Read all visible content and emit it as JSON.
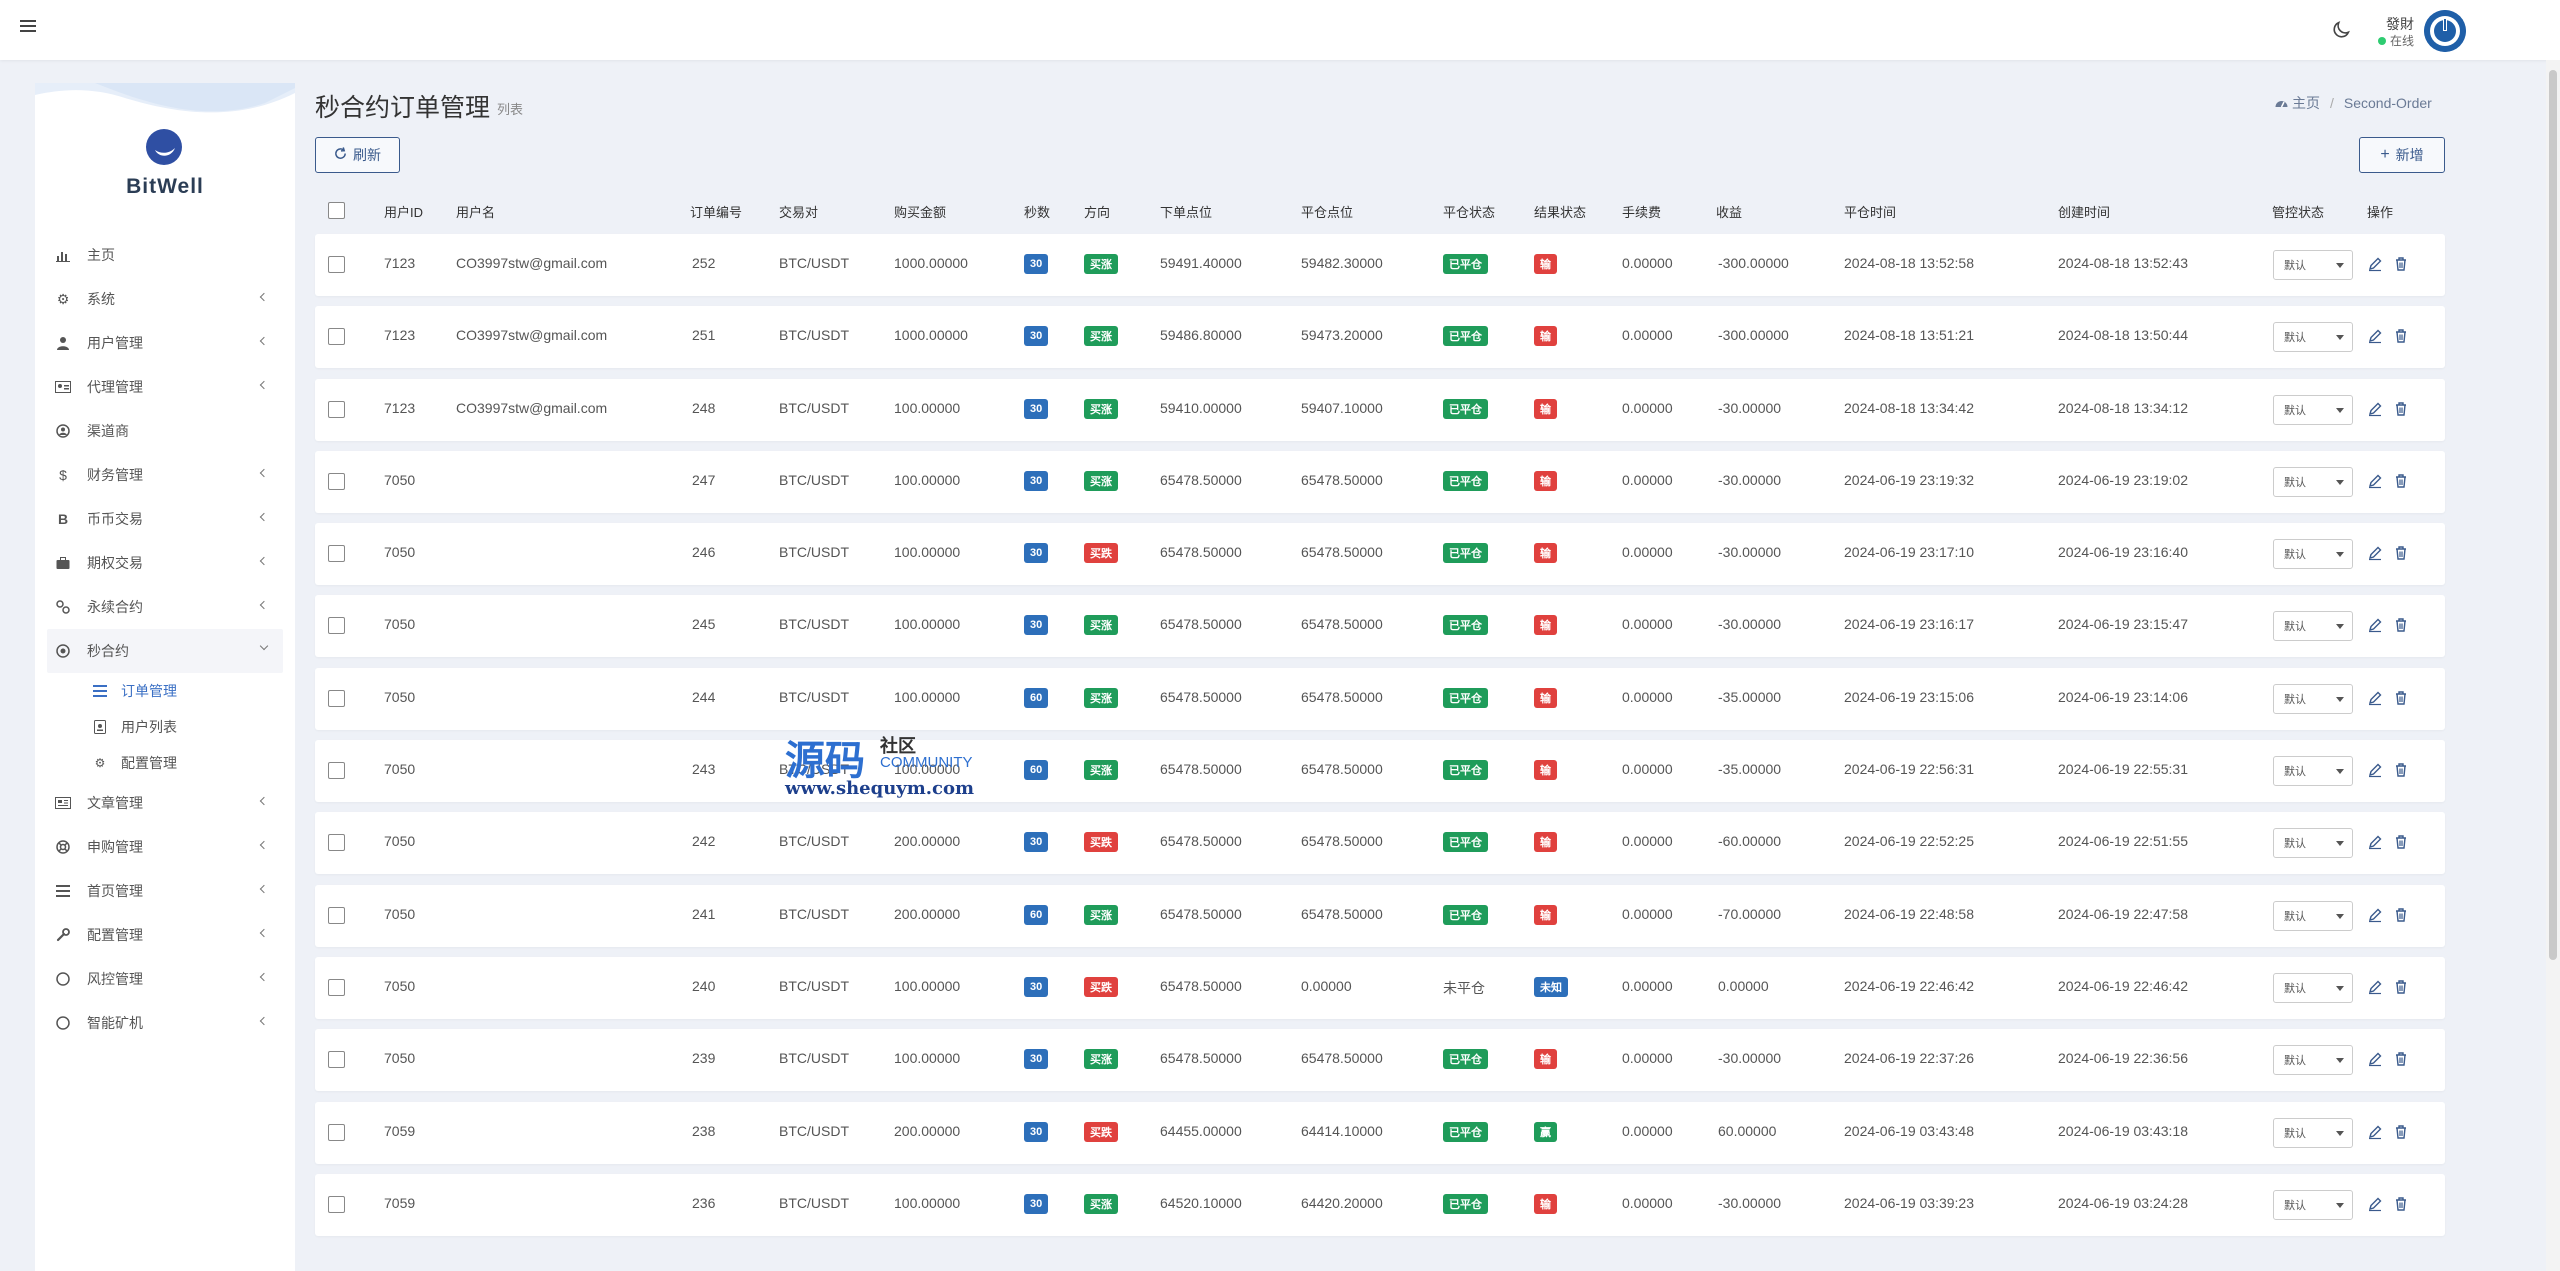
{
  "topbar": {
    "user_name": "發財",
    "user_status": "在线"
  },
  "brand": {
    "name": "BitWell"
  },
  "sidebar": {
    "items": [
      {
        "label": "主页",
        "icon": "chart-icon"
      },
      {
        "label": "系统",
        "icon": "gear-icon"
      },
      {
        "label": "用户管理",
        "icon": "user-icon"
      },
      {
        "label": "代理管理",
        "icon": "id-card-icon"
      },
      {
        "label": "渠道商",
        "icon": "user-circle-icon"
      },
      {
        "label": "财务管理",
        "icon": "dollar-icon"
      },
      {
        "label": "币币交易",
        "icon": "bitcoin-icon"
      },
      {
        "label": "期权交易",
        "icon": "briefcase-icon"
      },
      {
        "label": "永续合约",
        "icon": "link-icon"
      },
      {
        "label": "秒合约",
        "icon": "dot-circle-icon"
      }
    ],
    "sub_items": [
      {
        "label": "订单管理",
        "icon": "list-icon"
      },
      {
        "label": "用户列表",
        "icon": "id-badge-icon"
      },
      {
        "label": "配置管理",
        "icon": "gear-icon"
      }
    ],
    "items_after": [
      {
        "label": "文章管理",
        "icon": "newspaper-icon"
      },
      {
        "label": "申购管理",
        "icon": "life-ring-icon"
      },
      {
        "label": "首页管理",
        "icon": "bars-icon"
      },
      {
        "label": "配置管理",
        "icon": "wrench-icon"
      },
      {
        "label": "风控管理",
        "icon": "circle-icon"
      },
      {
        "label": "智能矿机",
        "icon": "circle-icon"
      }
    ]
  },
  "page": {
    "title": "秒合约订单管理",
    "subtitle": "列表",
    "breadcrumb_home": "主页",
    "breadcrumb_current": "Second-Order",
    "refresh_label": "刷新",
    "add_label": "新增"
  },
  "table": {
    "headers": {
      "user_id": "用户ID",
      "username": "用户名",
      "order_no": "订单编号",
      "pair": "交易对",
      "amount": "购买金额",
      "seconds": "秒数",
      "direction": "方向",
      "open_price": "下单点位",
      "close_price": "平仓点位",
      "close_status": "平仓状态",
      "result_status": "结果状态",
      "fee": "手续费",
      "profit": "收益",
      "close_time": "平仓时间",
      "create_time": "创建时间",
      "control_status": "管控状态",
      "actions": "操作"
    },
    "select_default": "默认",
    "rows": [
      {
        "user_id": "7123",
        "username": "CO3997stw@gmail.com",
        "order_no": "252",
        "pair": "BTC/USDT",
        "amount": "1000.00000",
        "seconds": "30",
        "direction": "买涨",
        "dir_color": "green",
        "open": "59491.40000",
        "close": "59482.30000",
        "close_status": "已平仓",
        "result": "输",
        "result_color": "red",
        "fee": "0.00000",
        "profit": "-300.00000",
        "close_time": "2024-08-18 13:52:58",
        "create_time": "2024-08-18 13:52:43"
      },
      {
        "user_id": "7123",
        "username": "CO3997stw@gmail.com",
        "order_no": "251",
        "pair": "BTC/USDT",
        "amount": "1000.00000",
        "seconds": "30",
        "direction": "买涨",
        "dir_color": "green",
        "open": "59486.80000",
        "close": "59473.20000",
        "close_status": "已平仓",
        "result": "输",
        "result_color": "red",
        "fee": "0.00000",
        "profit": "-300.00000",
        "close_time": "2024-08-18 13:51:21",
        "create_time": "2024-08-18 13:50:44"
      },
      {
        "user_id": "7123",
        "username": "CO3997stw@gmail.com",
        "order_no": "248",
        "pair": "BTC/USDT",
        "amount": "100.00000",
        "seconds": "30",
        "direction": "买涨",
        "dir_color": "green",
        "open": "59410.00000",
        "close": "59407.10000",
        "close_status": "已平仓",
        "result": "输",
        "result_color": "red",
        "fee": "0.00000",
        "profit": "-30.00000",
        "close_time": "2024-08-18 13:34:42",
        "create_time": "2024-08-18 13:34:12"
      },
      {
        "user_id": "7050",
        "username": "",
        "order_no": "247",
        "pair": "BTC/USDT",
        "amount": "100.00000",
        "seconds": "30",
        "direction": "买涨",
        "dir_color": "green",
        "open": "65478.50000",
        "close": "65478.50000",
        "close_status": "已平仓",
        "result": "输",
        "result_color": "red",
        "fee": "0.00000",
        "profit": "-30.00000",
        "close_time": "2024-06-19 23:19:32",
        "create_time": "2024-06-19 23:19:02"
      },
      {
        "user_id": "7050",
        "username": "",
        "order_no": "246",
        "pair": "BTC/USDT",
        "amount": "100.00000",
        "seconds": "30",
        "direction": "买跌",
        "dir_color": "red",
        "open": "65478.50000",
        "close": "65478.50000",
        "close_status": "已平仓",
        "result": "输",
        "result_color": "red",
        "fee": "0.00000",
        "profit": "-30.00000",
        "close_time": "2024-06-19 23:17:10",
        "create_time": "2024-06-19 23:16:40"
      },
      {
        "user_id": "7050",
        "username": "",
        "order_no": "245",
        "pair": "BTC/USDT",
        "amount": "100.00000",
        "seconds": "30",
        "direction": "买涨",
        "dir_color": "green",
        "open": "65478.50000",
        "close": "65478.50000",
        "close_status": "已平仓",
        "result": "输",
        "result_color": "red",
        "fee": "0.00000",
        "profit": "-30.00000",
        "close_time": "2024-06-19 23:16:17",
        "create_time": "2024-06-19 23:15:47"
      },
      {
        "user_id": "7050",
        "username": "",
        "order_no": "244",
        "pair": "BTC/USDT",
        "amount": "100.00000",
        "seconds": "60",
        "direction": "买涨",
        "dir_color": "green",
        "open": "65478.50000",
        "close": "65478.50000",
        "close_status": "已平仓",
        "result": "输",
        "result_color": "red",
        "fee": "0.00000",
        "profit": "-35.00000",
        "close_time": "2024-06-19 23:15:06",
        "create_time": "2024-06-19 23:14:06"
      },
      {
        "user_id": "7050",
        "username": "",
        "order_no": "243",
        "pair": "BTC/USDT",
        "amount": "100.00000",
        "seconds": "60",
        "direction": "买涨",
        "dir_color": "green",
        "open": "65478.50000",
        "close": "65478.50000",
        "close_status": "已平仓",
        "result": "输",
        "result_color": "red",
        "fee": "0.00000",
        "profit": "-35.00000",
        "close_time": "2024-06-19 22:56:31",
        "create_time": "2024-06-19 22:55:31"
      },
      {
        "user_id": "7050",
        "username": "",
        "order_no": "242",
        "pair": "BTC/USDT",
        "amount": "200.00000",
        "seconds": "30",
        "direction": "买跌",
        "dir_color": "red",
        "open": "65478.50000",
        "close": "65478.50000",
        "close_status": "已平仓",
        "result": "输",
        "result_color": "red",
        "fee": "0.00000",
        "profit": "-60.00000",
        "close_time": "2024-06-19 22:52:25",
        "create_time": "2024-06-19 22:51:55"
      },
      {
        "user_id": "7050",
        "username": "",
        "order_no": "241",
        "pair": "BTC/USDT",
        "amount": "200.00000",
        "seconds": "60",
        "direction": "买涨",
        "dir_color": "green",
        "open": "65478.50000",
        "close": "65478.50000",
        "close_status": "已平仓",
        "result": "输",
        "result_color": "red",
        "fee": "0.00000",
        "profit": "-70.00000",
        "close_time": "2024-06-19 22:48:58",
        "create_time": "2024-06-19 22:47:58"
      },
      {
        "user_id": "7050",
        "username": "",
        "order_no": "240",
        "pair": "BTC/USDT",
        "amount": "100.00000",
        "seconds": "30",
        "direction": "买跌",
        "dir_color": "red",
        "open": "65478.50000",
        "close": "0.00000",
        "close_status": "未平仓",
        "result": "未知",
        "result_color": "blue",
        "fee": "0.00000",
        "profit": "0.00000",
        "close_time": "2024-06-19 22:46:42",
        "create_time": "2024-06-19 22:46:42"
      },
      {
        "user_id": "7050",
        "username": "",
        "order_no": "239",
        "pair": "BTC/USDT",
        "amount": "100.00000",
        "seconds": "30",
        "direction": "买涨",
        "dir_color": "green",
        "open": "65478.50000",
        "close": "65478.50000",
        "close_status": "已平仓",
        "result": "输",
        "result_color": "red",
        "fee": "0.00000",
        "profit": "-30.00000",
        "close_time": "2024-06-19 22:37:26",
        "create_time": "2024-06-19 22:36:56"
      },
      {
        "user_id": "7059",
        "username": "",
        "order_no": "238",
        "pair": "BTC/USDT",
        "amount": "200.00000",
        "seconds": "30",
        "direction": "买跌",
        "dir_color": "red",
        "open": "64455.00000",
        "close": "64414.10000",
        "close_status": "已平仓",
        "result": "赢",
        "result_color": "green",
        "fee": "0.00000",
        "profit": "60.00000",
        "close_time": "2024-06-19 03:43:48",
        "create_time": "2024-06-19 03:43:18"
      },
      {
        "user_id": "7059",
        "username": "",
        "order_no": "236",
        "pair": "BTC/USDT",
        "amount": "100.00000",
        "seconds": "30",
        "direction": "买涨",
        "dir_color": "green",
        "open": "64520.10000",
        "close": "64420.20000",
        "close_status": "已平仓",
        "result": "输",
        "result_color": "red",
        "fee": "0.00000",
        "profit": "-30.00000",
        "close_time": "2024-06-19 03:39:23",
        "create_time": "2024-06-19 03:24:28"
      }
    ]
  },
  "watermark": {
    "big": "源码",
    "small": "社区",
    "community": "COMMUNITY",
    "url": "www.shequym.com"
  },
  "colors": {
    "primary": "#3a5a8c",
    "badge_blue": "#2d6fba",
    "badge_green": "#1f9c5a",
    "badge_red": "#e0413e"
  }
}
